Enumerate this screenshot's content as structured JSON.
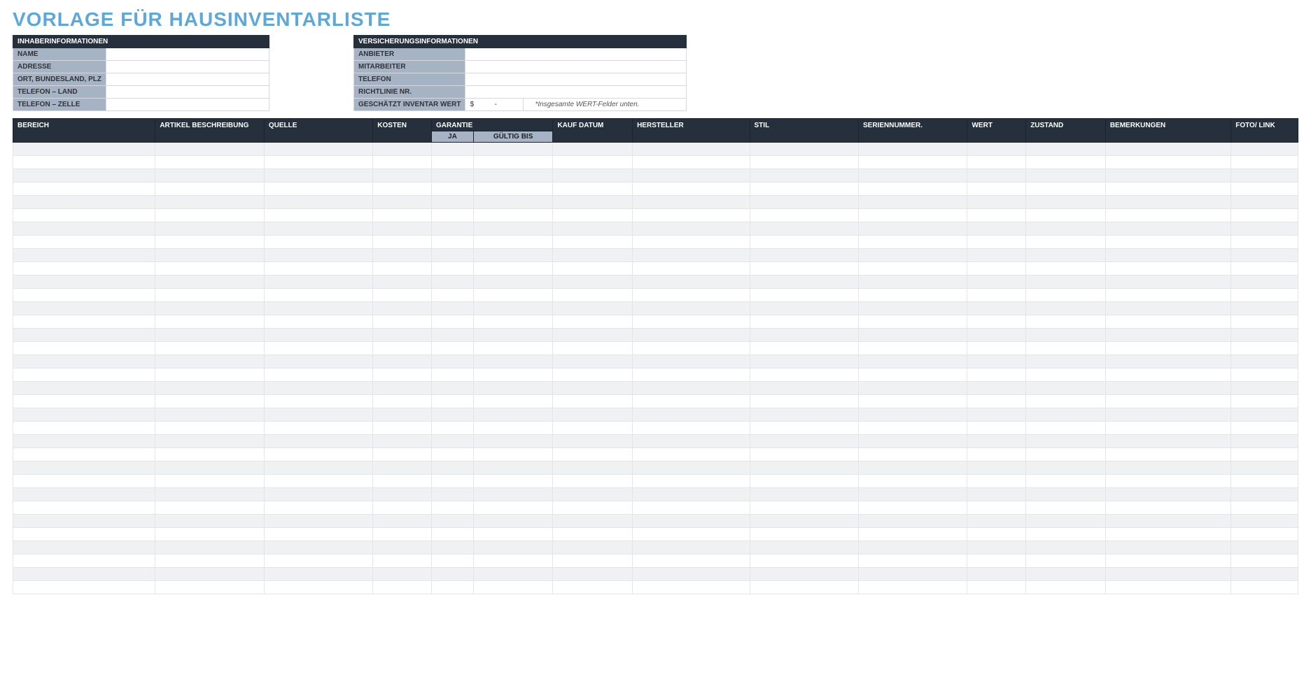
{
  "title": "VORLAGE FÜR HAUSINVENTARLISTE",
  "owner": {
    "section_title": "INHABERINFORMATIONEN",
    "rows": [
      {
        "label": "NAME",
        "value": ""
      },
      {
        "label": "ADRESSE",
        "value": ""
      },
      {
        "label": "ORT, BUNDESLAND, PLZ",
        "value": ""
      },
      {
        "label": "TELEFON – LAND",
        "value": ""
      },
      {
        "label": "TELEFON – ZELLE",
        "value": ""
      }
    ]
  },
  "insurance": {
    "section_title": "VERSICHERUNGSINFORMATIONEN",
    "rows": [
      {
        "label": "ANBIETER",
        "value": ""
      },
      {
        "label": "MITARBEITER",
        "value": ""
      },
      {
        "label": "TELEFON",
        "value": ""
      },
      {
        "label": "RICHTLINIE NR.",
        "value": ""
      }
    ],
    "estimated": {
      "label": "GESCHÄTZT INVENTAR WERT",
      "currency": "$",
      "value": "-",
      "note": "*Insgesamte WERT-Felder unten."
    }
  },
  "inventory": {
    "headers": {
      "bereich": "BEREICH",
      "artikel": "ARTIKEL BESCHREIBUNG",
      "quelle": "QUELLE",
      "kosten": "KOSTEN",
      "garantie": "GARANTIE",
      "garantie_ja": "JA",
      "garantie_bis": "GÜLTIG BIS",
      "kauf": "KAUF DATUM",
      "hersteller": "HERSTELLER",
      "stil": "STIL",
      "seriennummer": "SERIENNUMMER.",
      "wert": "WERT",
      "zustand": "ZUSTAND",
      "bemerkungen": "BEMERKUNGEN",
      "foto": "FOTO/ LINK"
    },
    "row_count": 34,
    "rows": []
  }
}
